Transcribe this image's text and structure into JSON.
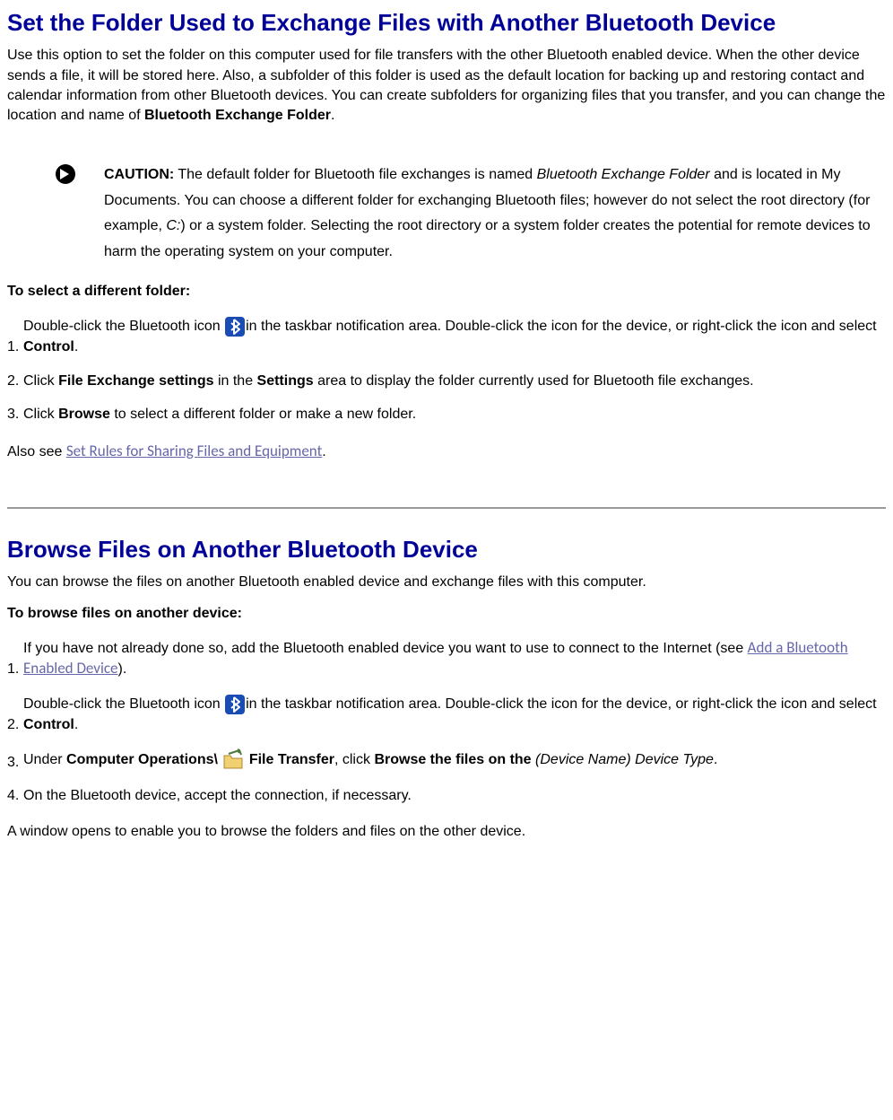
{
  "section1": {
    "title": "Set the Folder Used to Exchange Files with Another Bluetooth Device",
    "intro_pre": "Use this option to set the folder on this computer used for file transfers with the other Bluetooth enabled device. When the other device sends a file, it will be stored here. Also, a subfolder of this folder is used as the default location for backing up and restoring contact and calendar information from other Bluetooth devices. You can create subfolders for organizing files that you transfer, and you can change the location and name of ",
    "intro_bold": "Bluetooth Exchange Folder",
    "intro_post": ".",
    "caution_label": "CAUTION:",
    "caution_pre": " The default folder for Bluetooth file exchanges is named ",
    "caution_italic1": "Bluetooth Exchange Folder",
    "caution_mid": " and is located in My Documents. You can choose a different folder for exchanging Bluetooth files; however do not select the root directory (for example, ",
    "caution_italic2": "C:",
    "caution_post": ") or a system folder. Selecting the root directory or a system folder creates the potential for remote devices to harm the operating system on your computer.",
    "subhead": "To select a different folder:",
    "steps": [
      {
        "num": "1.",
        "pre": "Double-click the Bluetooth icon ",
        "mid": "in the taskbar notification area. Double-click the icon for the device, or right-click the icon and select ",
        "bold": "Control",
        "post": "."
      },
      {
        "num": "2.",
        "plain_pre": "Click ",
        "bold1": "File Exchange settings",
        "plain_mid": " in the ",
        "bold2": "Settings",
        "plain_post": " area to display the folder currently used for Bluetooth file exchanges."
      },
      {
        "num": "3.",
        "plain_pre": "Click ",
        "bold1": "Browse",
        "plain_post": " to select a different folder or make a new folder."
      }
    ],
    "alsosee_pre": "Also see ",
    "alsosee_link": "Set Rules for Sharing Files and Equipment",
    "alsosee_post": "."
  },
  "section2": {
    "title": "Browse Files on Another Bluetooth Device",
    "intro": "You can browse the files on another Bluetooth enabled device and exchange files with this computer.",
    "subhead": "To browse files on another device:",
    "steps": [
      {
        "num": "1.",
        "pre": "If you have not already done so, add the Bluetooth enabled device you want to use to connect to the Internet (see ",
        "link": "Add a Bluetooth Enabled Device",
        "post": ")."
      },
      {
        "num": "2.",
        "pre": "Double-click the Bluetooth icon ",
        "mid": "in the taskbar notification area. Double-click the icon for the device, or right-click the icon and select ",
        "bold": "Control",
        "post": "."
      },
      {
        "num": "3.",
        "pre": "Under ",
        "bold1": "Computer Operations\\ ",
        "bold2": " File Transfer",
        "mid2": ", click ",
        "bold3": "Browse the files on the ",
        "italic1": "(Device Name) Device Type",
        "post": "."
      },
      {
        "num": "4.",
        "plain": "On the Bluetooth device, accept the connection, if necessary."
      }
    ],
    "closing": "A window opens to enable you to browse the folders and files on the other device."
  }
}
